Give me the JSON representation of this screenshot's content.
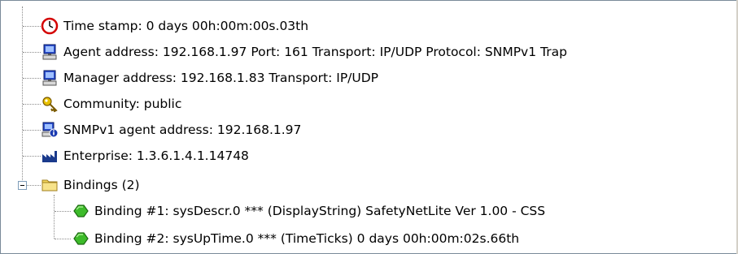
{
  "tree": {
    "items": [
      {
        "icon": "clock-icon",
        "label": "Time stamp: 0 days 00h:00m:00s.03th"
      },
      {
        "icon": "computer-icon",
        "label": "Agent address: 192.168.1.97 Port: 161 Transport: IP/UDP Protocol: SNMPv1 Trap"
      },
      {
        "icon": "computer-icon",
        "label": "Manager address: 192.168.1.83 Transport: IP/UDP"
      },
      {
        "icon": "key-icon",
        "label": "Community: public"
      },
      {
        "icon": "agent-info-icon",
        "label": "SNMPv1 agent address: 192.168.1.97"
      },
      {
        "icon": "enterprise-icon",
        "label": "Enterprise: 1.3.6.1.4.1.14748"
      },
      {
        "icon": "folder-icon",
        "label": "Bindings (2)",
        "expanded": true
      },
      {
        "icon": "binding-icon",
        "label": "Binding #1: sysDescr.0 *** (DisplayString) SafetyNetLite Ver 1.00 - CSS"
      },
      {
        "icon": "binding-icon",
        "label": "Binding #2: sysUpTime.0 *** (TimeTicks) 0 days 00h:00m:02s.66th"
      }
    ]
  },
  "colors": {
    "clock_ring": "#d40000",
    "computer_blue": "#2a4fd0",
    "key_yellow": "#e8c000",
    "folder_yellow": "#f2d55a",
    "binding_green": "#3dbb2a",
    "enterprise_navy": "#1a3a8c"
  }
}
